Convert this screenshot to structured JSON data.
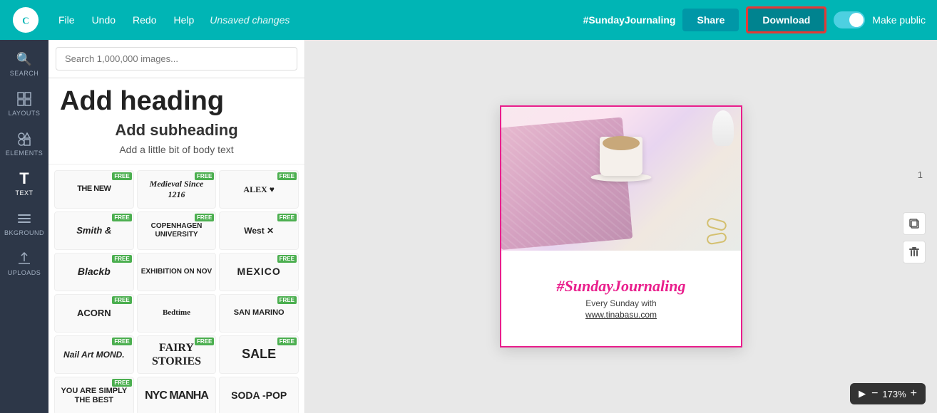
{
  "topnav": {
    "logo_text": "Canva",
    "menu": {
      "file": "File",
      "undo": "Undo",
      "redo": "Redo",
      "help": "Help"
    },
    "unsaved": "Unsaved changes",
    "hashtag": "#SundayJournaling",
    "share_label": "Share",
    "download_label": "Download",
    "make_public_label": "Make public"
  },
  "sidebar": {
    "items": [
      {
        "id": "search",
        "label": "SEARCH",
        "icon": "🔍"
      },
      {
        "id": "layouts",
        "label": "LAYOUTS",
        "icon": "⊞"
      },
      {
        "id": "elements",
        "label": "ELEMENTS",
        "icon": "✦"
      },
      {
        "id": "text",
        "label": "TEXT",
        "icon": "T"
      },
      {
        "id": "background",
        "label": "BKGROUND",
        "icon": "≋"
      },
      {
        "id": "uploads",
        "label": "UPLOADS",
        "icon": "↑"
      }
    ]
  },
  "panel": {
    "search_placeholder": "Search 1,000,000 images...",
    "add_heading": "Add heading",
    "add_subheading": "Add subheading",
    "add_body": "Add a little bit of body text",
    "fonts": [
      {
        "id": "the-new",
        "label": "THE NEW",
        "class": "fi-the-new",
        "free": true
      },
      {
        "id": "medieval",
        "label": "Medieval Since 1216",
        "class": "fi-medieval",
        "free": true
      },
      {
        "id": "alex",
        "label": "ALEX ♥",
        "class": "fi-alex",
        "free": true
      },
      {
        "id": "smith",
        "label": "Smith &",
        "class": "fi-smith",
        "free": true
      },
      {
        "id": "copenhagen",
        "label": "COPENHAGEN UNIVERSITY",
        "class": "fi-copenhagen",
        "free": true
      },
      {
        "id": "west",
        "label": "West ✕",
        "class": "fi-west",
        "free": true
      },
      {
        "id": "blackb",
        "label": "Blackb",
        "class": "fi-blackb",
        "free": true
      },
      {
        "id": "exhibition",
        "label": "EXHIBITION ON NOV",
        "class": "fi-exhibition",
        "free": false
      },
      {
        "id": "mexico",
        "label": "MEXICO",
        "class": "fi-mexico",
        "free": true
      },
      {
        "id": "acorn",
        "label": "ACORN",
        "class": "fi-acorn",
        "free": true
      },
      {
        "id": "bedtime",
        "label": "Bedtime",
        "class": "fi-bedtime",
        "free": false
      },
      {
        "id": "sanmarino",
        "label": "SAN MARINO",
        "class": "fi-sanmarino",
        "free": true
      },
      {
        "id": "nail",
        "label": "Nail Art MOND.",
        "class": "fi-nail",
        "free": true
      },
      {
        "id": "fairy",
        "label": "FAIRY STORIES",
        "class": "fi-fairy",
        "free": true
      },
      {
        "id": "sale",
        "label": "SALE",
        "class": "fi-sale",
        "free": true
      },
      {
        "id": "best",
        "label": "YOU ARE SIMPLY THE BEST",
        "class": "fi-best",
        "free": true
      },
      {
        "id": "nyc",
        "label": "NYC MANHA",
        "class": "fi-nyc",
        "free": false
      },
      {
        "id": "sodapop",
        "label": "SODA -POP",
        "class": "fi-sodapop",
        "free": false
      }
    ]
  },
  "canvas": {
    "page_number": "1",
    "design": {
      "hashtag": "#SundayJournaling",
      "subtitle": "Every Sunday with",
      "url": "www.tinabasu.com"
    }
  },
  "bottombar": {
    "present_icon": "▶",
    "zoom_out": "−",
    "zoom_level": "173%",
    "zoom_in": "+"
  }
}
